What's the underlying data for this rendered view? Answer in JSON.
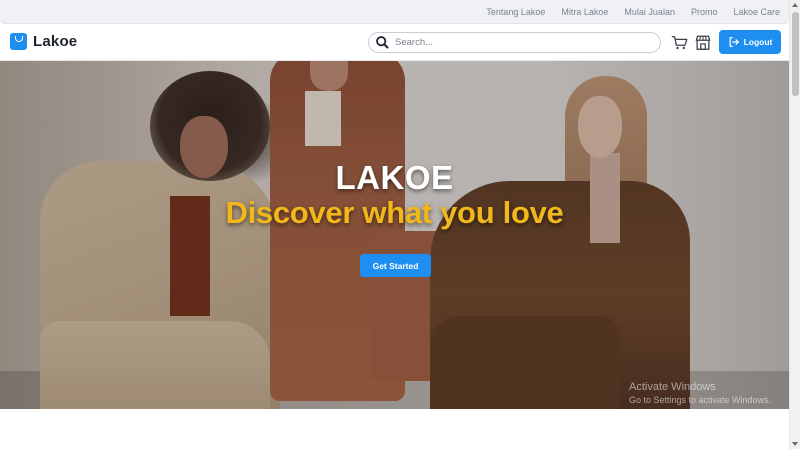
{
  "topbar": {
    "links": [
      "Tentang Lakoe",
      "Mitra Lakoe",
      "Mulai Jualan",
      "Promo",
      "Lakoe Care"
    ]
  },
  "header": {
    "brand": "Lakoe",
    "search_placeholder": "Search...",
    "cart_icon": "cart-icon",
    "store_icon": "store-icon",
    "logout_label": "Logout"
  },
  "hero": {
    "title": "LAKOE",
    "subtitle": "Discover what you love",
    "cta_label": "Get Started"
  },
  "watermark": {
    "line1": "Activate Windows",
    "line2": "Go to Settings to activate Windows."
  },
  "colors": {
    "accent": "#1f8ef1",
    "subtitle": "#f2b71b"
  }
}
